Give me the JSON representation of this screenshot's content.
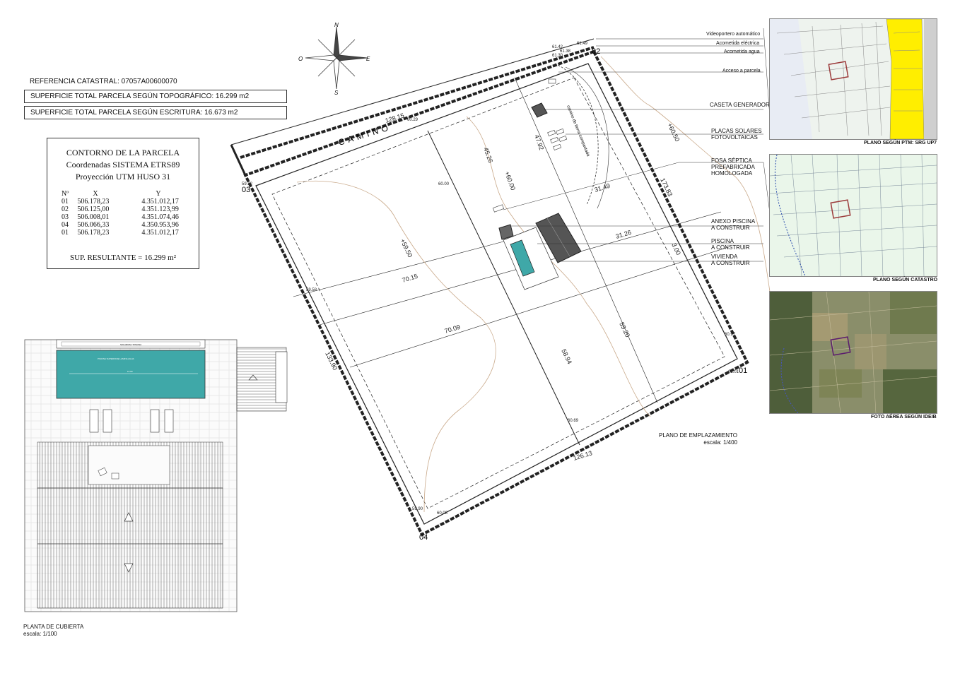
{
  "header": {
    "referencia": "REFERENCIA CATASTRAL: 07057A00600070",
    "superficie_topo": "SUPERFICIE TOTAL PARCELA SEGÚN TOPOGRÁFICO: 16.299 m2",
    "superficie_escritura": "SUPERFICIE TOTAL PARCELA SEGÚN ESCRITURA: 16.673 m2"
  },
  "contorno": {
    "title1": "CONTORNO DE LA PARCELA",
    "title2": "Coordenadas SISTEMA ETRS89",
    "title3": "Proyección UTM HUSO 31",
    "headers": [
      "Nº",
      "X",
      "Y"
    ],
    "rows": [
      [
        "01",
        "506.178,23",
        "4.351.012,17"
      ],
      [
        "02",
        "506.125,00",
        "4.351.123,99"
      ],
      [
        "03",
        "506.008,01",
        "4.351.074,46"
      ],
      [
        "04",
        "506.066,33",
        "4.350.953,96"
      ],
      [
        "01",
        "506.178,23",
        "4.351.012,17"
      ]
    ],
    "result": "SUP. RESULTANTE = 16.299 m²"
  },
  "compass": {
    "n": "N",
    "s": "S",
    "e": "E",
    "o": "O"
  },
  "site": {
    "camino": "CAMINO",
    "vertices": [
      "01",
      "02",
      "03",
      "04"
    ],
    "dims": [
      "128.15",
      "45.26",
      "47.92",
      "+60.00",
      "31.49",
      "31.26",
      "+60.50",
      "173.83",
      "+59.50",
      "70.15",
      "70.09",
      "133.90",
      "58.94",
      "59.20",
      "126.13",
      "3.00"
    ],
    "levels": [
      "61.42",
      "61.49",
      "61.38",
      "61.30",
      "60.29",
      "59.82",
      "60.00",
      "59.58",
      "60.97",
      "61.01",
      "60.69",
      "59.90",
      "60.08"
    ],
    "path_label": "camino de tierra compactada"
  },
  "legend": {
    "videoportero": "Videoportero automático",
    "acometida_electrica": "Acometida eléctrica",
    "acometida_agua": "Acometida agua",
    "acceso": "Acceso a parcela",
    "caseta": "CASETA GENERADOR",
    "placas_1": "PLACAS SOLARES",
    "placas_2": "FOTOVOLTAICAS",
    "fosa_1": "FOSA SÉPTICA",
    "fosa_2": "PREFABRICADA",
    "fosa_3": "HOMOLOGADA",
    "anexo_1": "ANEXO PISCINA",
    "anexo_2": "A CONSTRUIR",
    "piscina_1": "PISCINA",
    "piscina_2": "A CONSTRUIR",
    "vivienda_1": "VIVIENDA",
    "vivienda_2": "A CONSTRUIR"
  },
  "plan_title": {
    "title": "PLANO DE EMPLAZAMIENTO",
    "scale": "escala: 1/400"
  },
  "roof_title": {
    "title": "PLANTA DE CUBIERTA",
    "scale": "escala: 1/100"
  },
  "pool_plan": {
    "label": "SOLARIUM / PISCINA",
    "pool_note": "PISCINA SUPERFICIE LAMINA AGUA",
    "pool_dim": "12.00"
  },
  "maps": [
    {
      "caption": "PLANO SEGÚN PTM: SRG UP7"
    },
    {
      "caption": "PLANO SEGÚN CATASTRO"
    },
    {
      "caption": "FOTO AÉREA SEGÚN IDEIB"
    }
  ],
  "colors": {
    "line": "#222222",
    "contour": "#c9a98a",
    "pool": "#3fa8a8",
    "yellow": "#ffee00",
    "plot": "#9c3b3b"
  }
}
